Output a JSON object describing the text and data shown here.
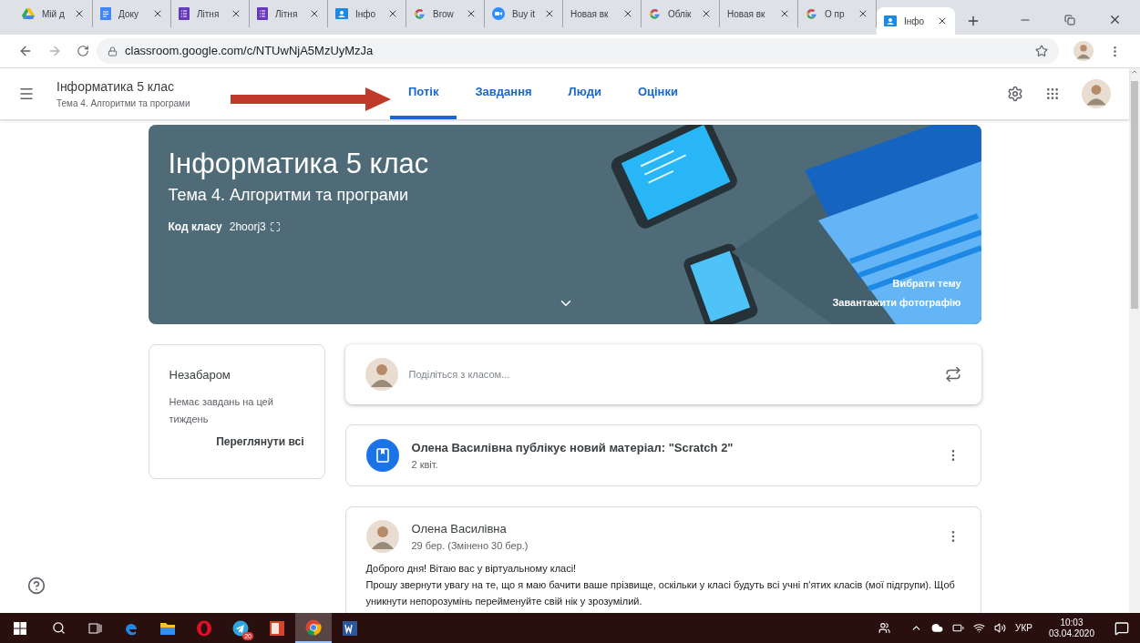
{
  "browser": {
    "tabs": [
      {
        "title": "Мій д",
        "selected": false
      },
      {
        "title": "Доку",
        "selected": false
      },
      {
        "title": "Літня",
        "selected": false
      },
      {
        "title": "Літня",
        "selected": false
      },
      {
        "title": "Інфо",
        "selected": false
      },
      {
        "title": "Brow",
        "selected": false
      },
      {
        "title": "Buy it",
        "selected": false
      },
      {
        "title": "Новая вк",
        "selected": false
      },
      {
        "title": "Облік",
        "selected": false
      },
      {
        "title": "Новая вк",
        "selected": false
      },
      {
        "title": "О пр",
        "selected": false
      },
      {
        "title": "Інфо",
        "selected": true
      }
    ],
    "address": "classroom.google.com/c/NTUwNjA5MzUyMzJa"
  },
  "header": {
    "class_name": "Інформатика 5 клас",
    "section": "Тема 4. Алгоритми та програми",
    "nav": [
      {
        "label": "Потік",
        "selected": true
      },
      {
        "label": "Завдання",
        "selected": false
      },
      {
        "label": "Люди",
        "selected": false
      },
      {
        "label": "Оцінки",
        "selected": false
      }
    ]
  },
  "banner": {
    "title": "Інформатика 5 клас",
    "subtitle": "Тема 4. Алгоритми та програми",
    "code_label": "Код класу",
    "code": "2hoorj3",
    "links": [
      "Вибрати тему",
      "Завантажити фотографію"
    ]
  },
  "upcoming": {
    "title": "Незабаром",
    "text": "Немає завдань на цей тиждень",
    "link": "Переглянути всі"
  },
  "share": {
    "placeholder": "Поділіться з класом..."
  },
  "posts": [
    {
      "kind": "material",
      "text": "Олена Василівна публікує новий матеріал: \"Scratch 2\"",
      "date": "2 квіт."
    },
    {
      "kind": "announcement",
      "author": "Олена Василівна",
      "date": "29 бер. (Змінено 30 бер.)",
      "paragraphs": [
        "Доброго дня! Вітаю вас у віртуальному класі!",
        "Прошу звернути увагу на те, що я маю бачити ваше прізвище, оскільки у класі будуть всі учні п'ятих класів (мої підгрупи). Щоб уникнути непорозумінь перейменуйте свій нік у зрозумілий."
      ]
    }
  ],
  "taskbar": {
    "apps": [
      {
        "active": false
      },
      {
        "active": false
      },
      {
        "active": false
      },
      {
        "active": false
      },
      {
        "active": false
      },
      {
        "active": false,
        "badge": "20"
      },
      {
        "active": false
      },
      {
        "active": true
      },
      {
        "active": false
      }
    ],
    "language": "УКР",
    "time": "10:03",
    "date": "03.04.2020"
  }
}
